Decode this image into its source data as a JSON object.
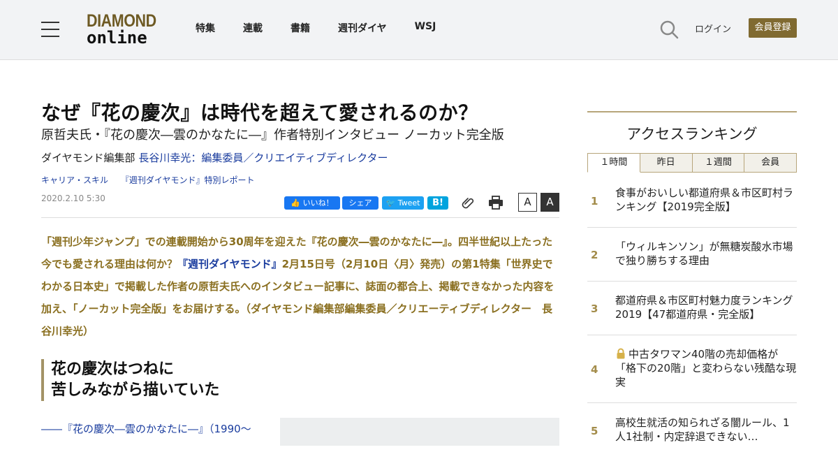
{
  "header": {
    "logo_top": "DIAMOND",
    "logo_bottom": "online",
    "nav": [
      "特集",
      "連載",
      "書籍",
      "週刊ダイヤ",
      "WSJ"
    ],
    "login": "ログイン",
    "register": "会員登録"
  },
  "article": {
    "title": "なぜ『花の慶次』は時代を超えて愛されるのか？",
    "subtitle": "原哲夫氏・『花の慶次―雲のかなたに―』作者特別インタビュー ノーカット完全版",
    "byline_prefix": "ダイヤモンド編集部",
    "byline_author": "長谷川幸光：編集委員／クリエイティブディレクター",
    "tags": [
      "キャリア・スキル",
      "『週刊ダイヤモンド』特別レポート"
    ],
    "date": "2020.2.10 5:30",
    "share": {
      "like": "いいね！",
      "share": "シェア",
      "tweet": "Tweet",
      "hatena": "B!"
    },
    "font_small": "A",
    "font_large": "A",
    "lead_1": "「週刊少年ジャンプ」での連載開始から30周年を迎えた『花の慶次―雲のかなたに―』。四半世紀以上たった今でも愛される理由は何か？",
    "lead_link": "『週刊ダイヤモンド』",
    "lead_2": "2月15日号（2月10日〈月〉発売）の第1特集「世界史でわかる日本史」で掲載した作者の原哲夫氏へのインタビュー記事に、誌面の都合上、掲載できなかった内容を加え、「ノーカット完全版」をお届けする。（ダイヤモンド編集部編集委員／クリエーティブディレクター　長谷川幸光）",
    "section_line1": "花の慶次はつねに",
    "section_line2": "苦しみながら描いていた",
    "body_first": "――『花の慶次―雲のかなたに―』（1990～"
  },
  "sidebar": {
    "title": "アクセスランキング",
    "tabs": [
      "１時間",
      "昨日",
      "１週間",
      "会員"
    ],
    "ranking": [
      {
        "num": "1",
        "text": "食事がおいしい都道府県＆市区町村ランキング【2019完全版】",
        "locked": false
      },
      {
        "num": "2",
        "text": "「ウィルキンソン」が無糖炭酸水市場で独り勝ちする理由",
        "locked": false
      },
      {
        "num": "3",
        "text": "都道府県＆市区町村魅力度ランキング2019【47都道府県・完全版】",
        "locked": false
      },
      {
        "num": "4",
        "text": "中古タワマン40階の売却価格が「格下の20階」と変わらない残酷な現実",
        "locked": true
      },
      {
        "num": "5",
        "text": "高校生就活の知られざる闇ルール、1人1社制・内定辞退できない…",
        "locked": false
      }
    ]
  },
  "colors": {
    "brand_gold": "#806a31",
    "lead_text": "#8a6f20",
    "link_blue": "#1a3c9e"
  }
}
